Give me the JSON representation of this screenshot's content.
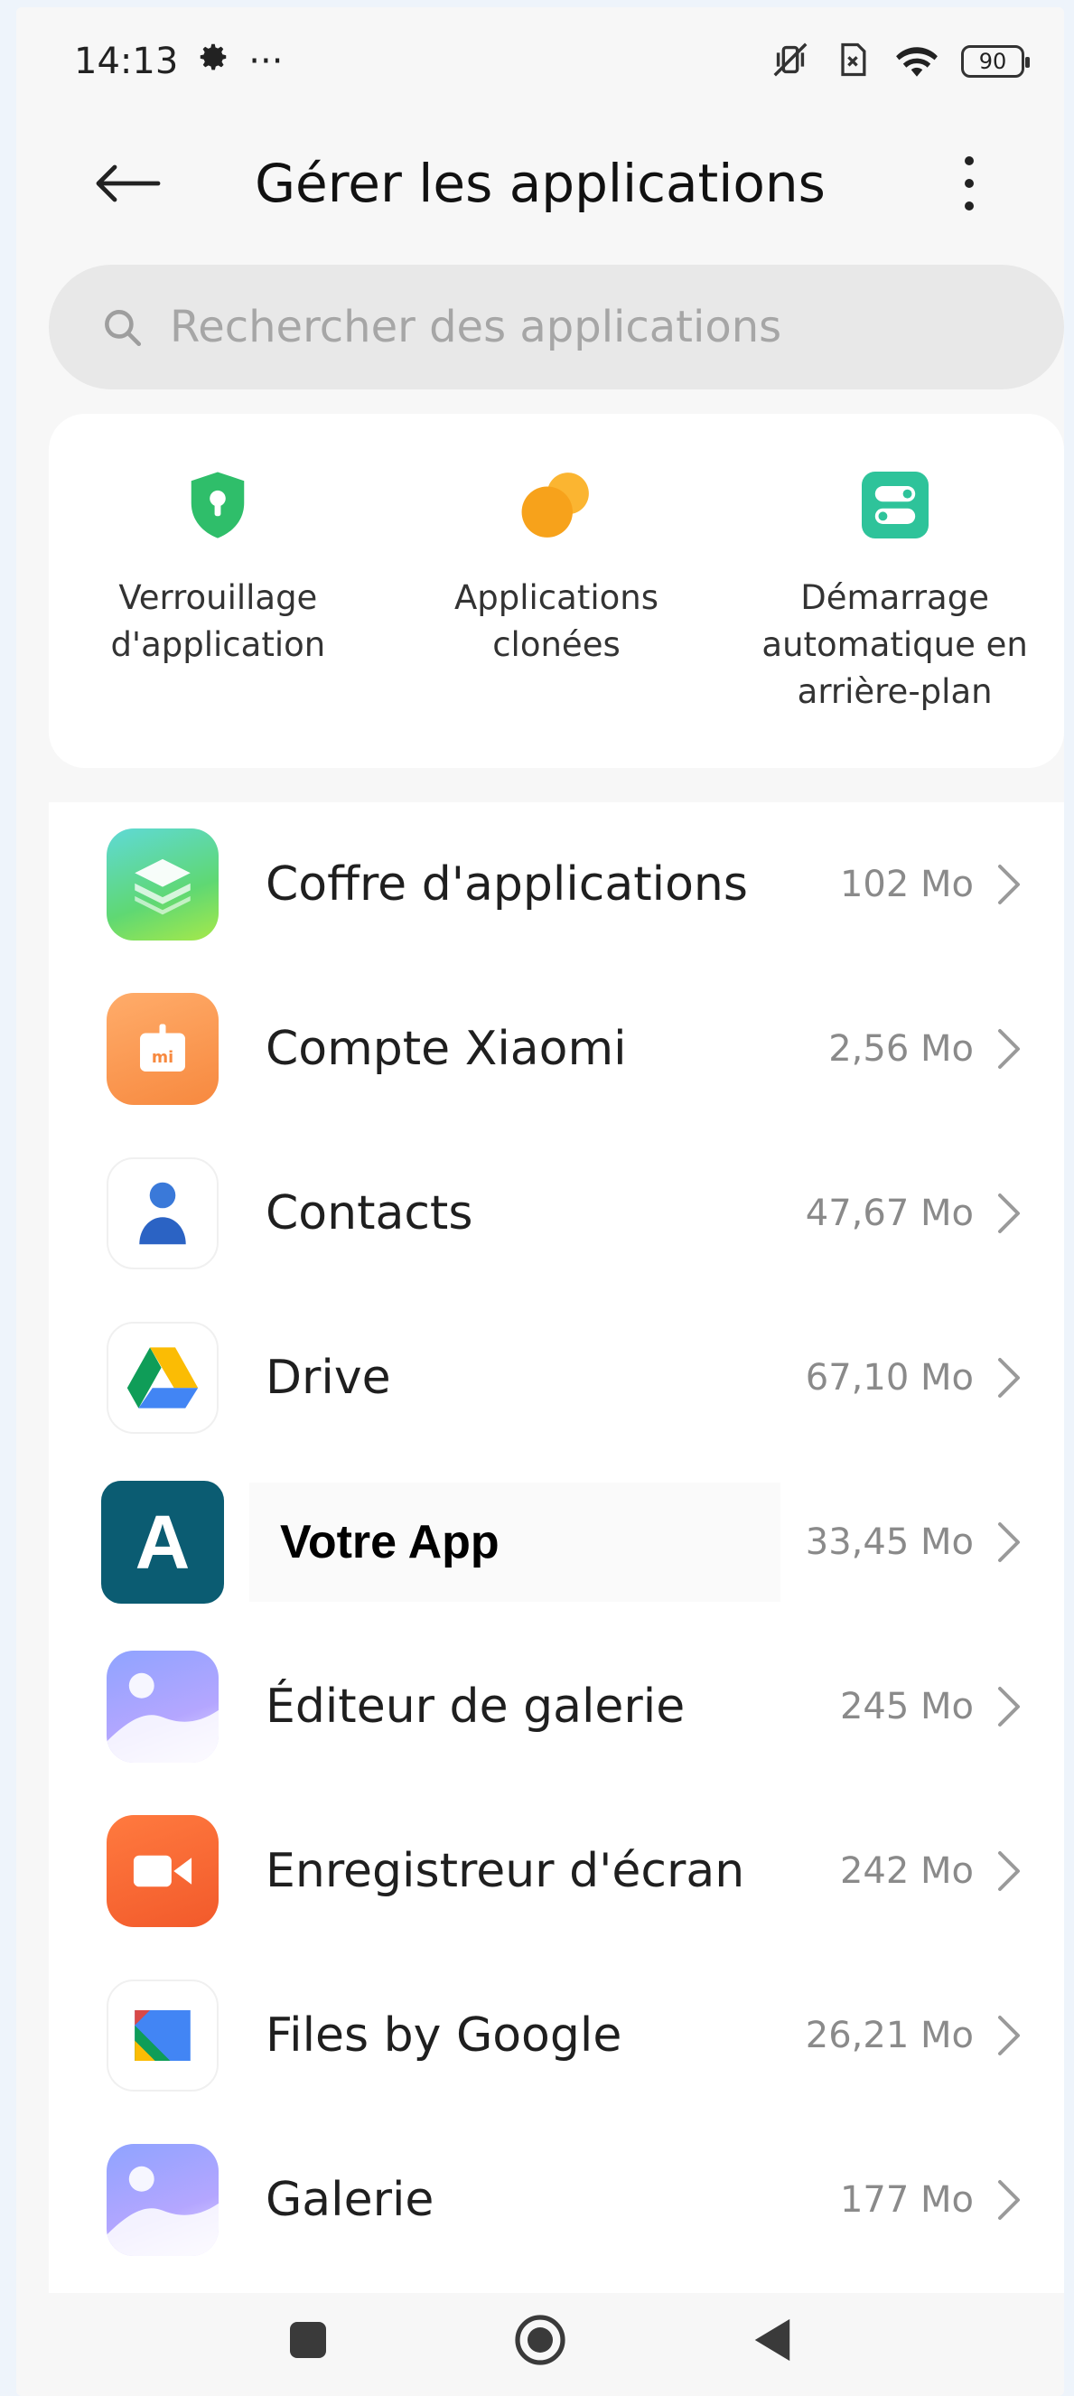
{
  "status_bar": {
    "time": "14:13",
    "more": "···",
    "battery": "90"
  },
  "header": {
    "title": "Gérer les applications"
  },
  "search": {
    "placeholder": "Rechercher des applications"
  },
  "features": [
    {
      "label": "Verrouillage\nd'application",
      "icon": "shield-lock-icon",
      "color": "#2fbe6a"
    },
    {
      "label": "Applications\nclonées",
      "icon": "clone-circles-icon",
      "color": "#f7a21b"
    },
    {
      "label": "Démarrage\nautomatique en\narrière-plan",
      "icon": "toggle-icon",
      "color": "#2ec39a"
    }
  ],
  "apps": [
    {
      "name": "Coffre d'applications",
      "size": "102 Mo",
      "icon": "app-vault-icon"
    },
    {
      "name": "Compte Xiaomi",
      "size": "2,56 Mo",
      "icon": "xiaomi-account-icon"
    },
    {
      "name": "Contacts",
      "size": "47,67 Mo",
      "icon": "contacts-icon"
    },
    {
      "name": "Drive",
      "size": "67,10 Mo",
      "icon": "drive-icon"
    },
    {
      "name": "Votre App",
      "size": "33,45 Mo",
      "icon": "votre-app-icon",
      "letter": "A"
    },
    {
      "name": "Éditeur de galerie",
      "size": "245 Mo",
      "icon": "gallery-editor-icon"
    },
    {
      "name": "Enregistreur d'écran",
      "size": "242 Mo",
      "icon": "screen-recorder-icon"
    },
    {
      "name": "Files by Google",
      "size": "26,21 Mo",
      "icon": "files-icon"
    },
    {
      "name": "Galerie",
      "size": "177 Mo",
      "icon": "gallery-icon"
    }
  ],
  "colors": {
    "accent_green": "#2fbe6a",
    "accent_orange": "#f7a21b",
    "votre_app_bg": "#0b5c72"
  }
}
